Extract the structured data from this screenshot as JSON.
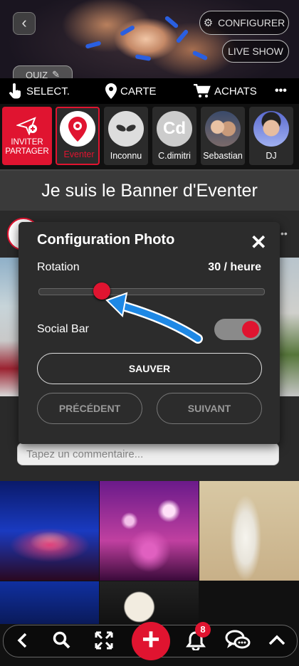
{
  "header": {
    "back_icon": "chevron-left-icon",
    "configure_label": "CONFIGURER",
    "live_show_label": "LIVE SHOW",
    "quiz_label": "QUIZ"
  },
  "nav": {
    "select_label": "SELECT.",
    "map_label": "CARTE",
    "shop_label": "ACHATS",
    "more_label": "•••"
  },
  "stories": {
    "invite_label_1": "INVITER",
    "invite_label_2": "PARTAGER",
    "items": [
      {
        "name": "Eventer"
      },
      {
        "name": "Inconnu"
      },
      {
        "name": "C.dimitri",
        "initials": "Cd"
      },
      {
        "name": "Sebastian"
      },
      {
        "name": "DJ"
      }
    ]
  },
  "banner": {
    "text": "Je suis le Banner d'Eventer"
  },
  "modal": {
    "title": "Configuration Photo",
    "close": "✕",
    "rotation_label": "Rotation",
    "rotation_value": "30 / heure",
    "rotation_fraction": 0.28,
    "social_bar_label": "Social Bar",
    "social_bar_on": true,
    "save_label": "SAUVER",
    "previous_label": "PRÉCÉDENT",
    "next_label": "SUIVANT"
  },
  "comment": {
    "placeholder": "Tapez un commentaire..."
  },
  "bottom": {
    "notification_count": "8"
  },
  "colors": {
    "accent": "#e01430",
    "nav_bg": "#000000",
    "modal_bg": "#2c2c2c"
  }
}
